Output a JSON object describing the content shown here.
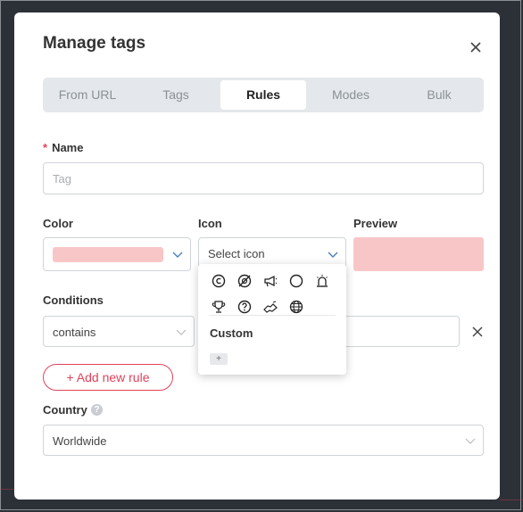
{
  "modal": {
    "title": "Manage tags"
  },
  "tabs": [
    {
      "label": "From URL",
      "active": false
    },
    {
      "label": "Tags",
      "active": false
    },
    {
      "label": "Rules",
      "active": true
    },
    {
      "label": "Modes",
      "active": false
    },
    {
      "label": "Bulk",
      "active": false
    }
  ],
  "name_field": {
    "label": "Name",
    "required_mark": "*",
    "placeholder": "Tag",
    "value": ""
  },
  "color_field": {
    "label": "Color",
    "selected_color": "#f8c6c7"
  },
  "icon_field": {
    "label": "Icon",
    "placeholder": "Select icon",
    "dropdown": {
      "icons": [
        "copyright-icon",
        "no-entry-icon",
        "megaphone-icon",
        "circle-icon",
        "siren-icon",
        "trophy-icon",
        "question-circle-icon",
        "handshake-icon",
        "globe-icon"
      ],
      "custom_label": "Custom",
      "add_label": "+"
    }
  },
  "preview": {
    "label": "Preview",
    "color": "#f8c6c7"
  },
  "conditions": {
    "label": "Conditions",
    "operator": "contains",
    "value": ""
  },
  "add_rule_label": "+ Add new rule",
  "country": {
    "label": "Country",
    "help": "?",
    "value": "Worldwide"
  },
  "colors": {
    "accent": "#e0435a",
    "tab_bg": "#e4e8ec",
    "chevron_blue": "#4a7fc1"
  }
}
